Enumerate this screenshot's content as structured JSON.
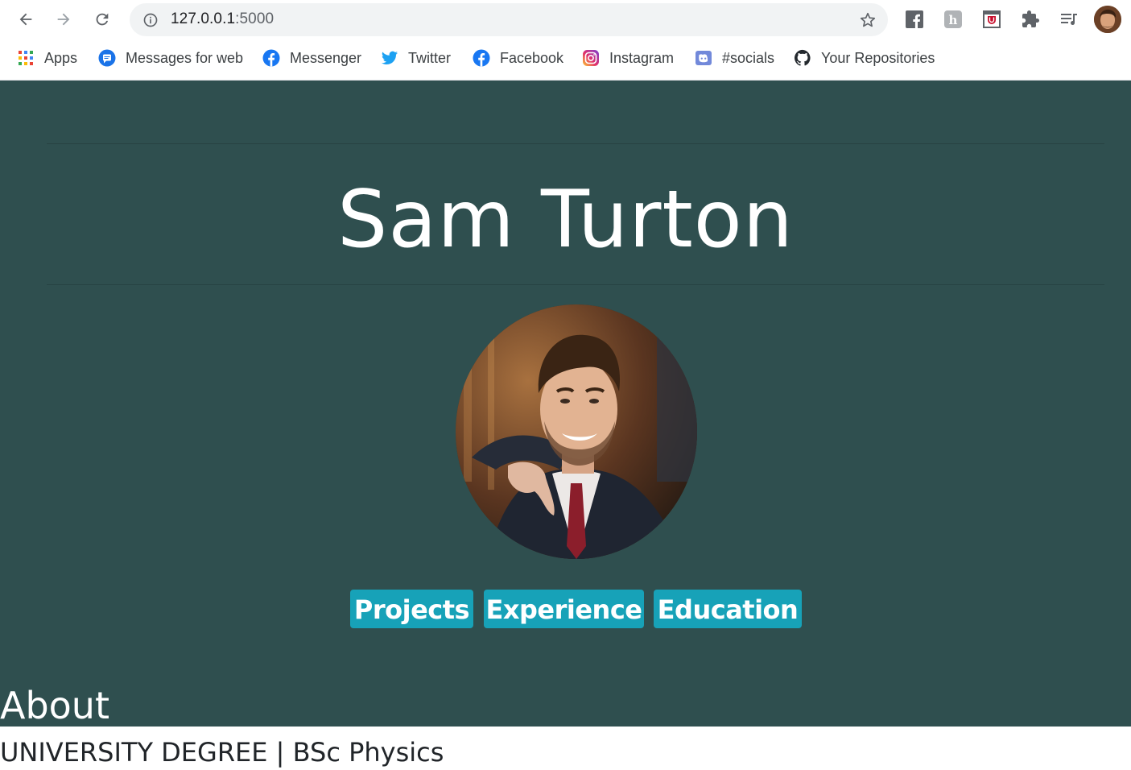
{
  "browser": {
    "url_host": "127.0.0.1",
    "url_port": ":5000",
    "bookmarks": [
      {
        "label": "Apps",
        "icon": "apps-grid-icon"
      },
      {
        "label": "Messages for web",
        "icon": "messages-icon"
      },
      {
        "label": "Messenger",
        "icon": "facebook-icon"
      },
      {
        "label": "Twitter",
        "icon": "twitter-icon"
      },
      {
        "label": "Facebook",
        "icon": "facebook-icon"
      },
      {
        "label": "Instagram",
        "icon": "instagram-icon"
      },
      {
        "label": "#socials",
        "icon": "discord-icon"
      },
      {
        "label": "Your Repositories",
        "icon": "github-icon"
      }
    ]
  },
  "page": {
    "name": "Sam Turton",
    "nav_buttons": [
      "Projects",
      "Experience",
      "Education"
    ],
    "section_title": "About",
    "degree": "UNIVERSITY DEGREE | BSc Physics"
  },
  "colors": {
    "hero_background": "#2f4f4f",
    "button_background": "#17a2b8",
    "button_text": "#ffffff"
  }
}
